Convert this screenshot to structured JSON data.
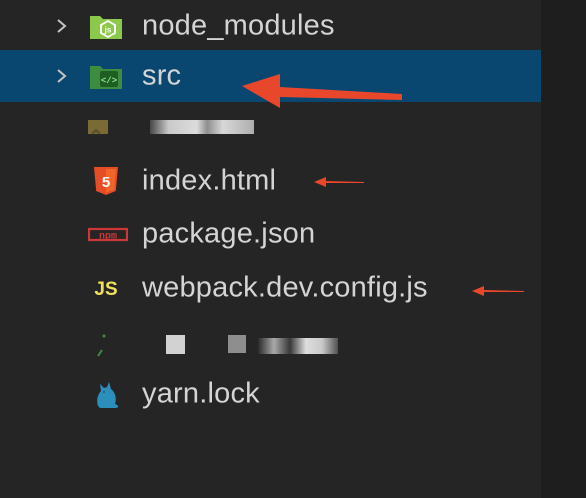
{
  "colors": {
    "panel_bg": "#252526",
    "selected_bg": "#094771",
    "text": "#d4d4d4",
    "chevron": "#c5c5c5",
    "arrow_red": "#e8472b",
    "html_orange": "#e44d26",
    "npm_red": "#cb3837",
    "js_yellow": "#f1e05a",
    "yarn_blue": "#2c8ebb",
    "node_green": "#8cc84b",
    "src_green": "#3d8c40"
  },
  "explorer": {
    "items": [
      {
        "label": "node_modules",
        "icon": "nodejs-folder-icon",
        "type": "folder"
      },
      {
        "label": "src",
        "icon": "src-folder-icon",
        "type": "folder",
        "selected": true
      },
      {
        "label": "",
        "icon": "redacted-folder-icon",
        "type": "folder",
        "redacted": true
      },
      {
        "label": "index.html",
        "icon": "html5-icon",
        "type": "file"
      },
      {
        "label": "package.json",
        "icon": "npm-icon",
        "type": "file"
      },
      {
        "label": "webpack.dev.config.js",
        "icon": "js-icon",
        "type": "file"
      },
      {
        "label": "",
        "icon": "redacted-file-icon",
        "type": "file",
        "redacted": true
      },
      {
        "label": "yarn.lock",
        "icon": "yarn-cat-icon",
        "type": "file"
      }
    ]
  },
  "icons": {
    "js_text": "JS",
    "npm_text": "npm",
    "html_text": "5"
  }
}
